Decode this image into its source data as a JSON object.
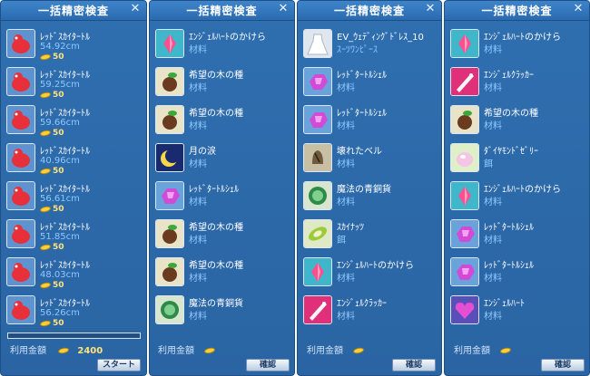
{
  "panels": [
    {
      "title": "一括精密検査",
      "items": [
        {
          "name": "ﾚｯﾄﾞｽｶｲﾀｰﾄﾙ",
          "sub": "54.92cm",
          "cost": "50",
          "icon": "red-sky-turtle-icon"
        },
        {
          "name": "ﾚｯﾄﾞｽｶｲﾀｰﾄﾙ",
          "sub": "59.25cm",
          "cost": "50",
          "icon": "red-sky-turtle-icon"
        },
        {
          "name": "ﾚｯﾄﾞｽｶｲﾀｰﾄﾙ",
          "sub": "59.66cm",
          "cost": "50",
          "icon": "red-sky-turtle-icon"
        },
        {
          "name": "ﾚｯﾄﾞｽｶｲﾀｰﾄﾙ",
          "sub": "40.96cm",
          "cost": "50",
          "icon": "red-sky-turtle-icon"
        },
        {
          "name": "ﾚｯﾄﾞｽｶｲﾀｰﾄﾙ",
          "sub": "56.61cm",
          "cost": "50",
          "icon": "red-sky-turtle-icon"
        },
        {
          "name": "ﾚｯﾄﾞｽｶｲﾀｰﾄﾙ",
          "sub": "51.85cm",
          "cost": "50",
          "icon": "red-sky-turtle-icon"
        },
        {
          "name": "ﾚｯﾄﾞｽｶｲﾀｰﾄﾙ",
          "sub": "48.03cm",
          "cost": "50",
          "icon": "red-sky-turtle-icon"
        },
        {
          "name": "ﾚｯﾄﾞｽｶｲﾀｰﾄﾙ",
          "sub": "56.26cm",
          "cost": "50",
          "icon": "red-sky-turtle-icon"
        }
      ],
      "progress": 0,
      "usage_label": "利用金額",
      "total": "2400",
      "button": "スタート"
    },
    {
      "title": "一括精密検査",
      "items": [
        {
          "name": "ｴﾝｼﾞｪﾙﾊｰﾄのかけら",
          "sub": "材料",
          "icon": "angel-heart-fragment-icon"
        },
        {
          "name": "希望の木の種",
          "sub": "材料",
          "icon": "hope-tree-seed-icon"
        },
        {
          "name": "希望の木の種",
          "sub": "材料",
          "icon": "hope-tree-seed-icon"
        },
        {
          "name": "月の涙",
          "sub": "材料",
          "icon": "moon-tear-icon"
        },
        {
          "name": "ﾚｯﾄﾞﾀｰﾄﾙｼｪﾙ",
          "sub": "材料",
          "icon": "red-turtle-shell-icon"
        },
        {
          "name": "希望の木の種",
          "sub": "材料",
          "icon": "hope-tree-seed-icon"
        },
        {
          "name": "希望の木の種",
          "sub": "材料",
          "icon": "hope-tree-seed-icon"
        },
        {
          "name": "魔法の青銅貨",
          "sub": "材料",
          "icon": "magic-bronze-coin-icon"
        }
      ],
      "usage_label": "利用金額",
      "button": "確認"
    },
    {
      "title": "一括精密検査",
      "items": [
        {
          "name": "EV_ｳｪﾃﾞｨﾝｸﾞﾄﾞﾚｽ_10",
          "sub": "ｽｰﾂﾜﾝﾋﾟｰｽ",
          "icon": "wedding-dress-icon"
        },
        {
          "name": "ﾚｯﾄﾞﾀｰﾄﾙｼｪﾙ",
          "sub": "材料",
          "icon": "red-turtle-shell-icon"
        },
        {
          "name": "ﾚｯﾄﾞﾀｰﾄﾙｼｪﾙ",
          "sub": "材料",
          "icon": "red-turtle-shell-icon"
        },
        {
          "name": "壊れたベル",
          "sub": "材料",
          "icon": "broken-bell-icon"
        },
        {
          "name": "魔法の青銅貨",
          "sub": "材料",
          "icon": "magic-bronze-coin-icon"
        },
        {
          "name": "ｽｶｲﾅｯﾂ",
          "sub": "餌",
          "icon": "sky-nuts-icon"
        },
        {
          "name": "ｴﾝｼﾞｪﾙﾊｰﾄのかけら",
          "sub": "材料",
          "icon": "angel-heart-fragment-icon"
        },
        {
          "name": "ｴﾝｼﾞｪﾙｸﾗｯｶｰ",
          "sub": "材料",
          "icon": "angel-cracker-icon"
        }
      ],
      "usage_label": "利用金額",
      "button": "確認"
    },
    {
      "title": "一括精密検査",
      "items": [
        {
          "name": "ｴﾝｼﾞｪﾙﾊｰﾄのかけら",
          "sub": "材料",
          "icon": "angel-heart-fragment-icon"
        },
        {
          "name": "ｴﾝｼﾞｪﾙｸﾗｯｶｰ",
          "sub": "材料",
          "icon": "angel-cracker-icon"
        },
        {
          "name": "希望の木の種",
          "sub": "材料",
          "icon": "hope-tree-seed-icon"
        },
        {
          "name": "ﾀﾞｲﾔﾓﾝﾄﾞｾﾞﾘｰ",
          "sub": "餌",
          "icon": "diamond-jelly-icon"
        },
        {
          "name": "ｴﾝｼﾞｪﾙﾊｰﾄのかけら",
          "sub": "材料",
          "icon": "angel-heart-fragment-icon"
        },
        {
          "name": "ﾚｯﾄﾞﾀｰﾄﾙｼｪﾙ",
          "sub": "材料",
          "icon": "red-turtle-shell-icon"
        },
        {
          "name": "ﾚｯﾄﾞﾀｰﾄﾙｼｪﾙ",
          "sub": "材料",
          "icon": "red-turtle-shell-icon"
        },
        {
          "name": "ｴﾝｼﾞｪﾙﾊｰﾄ",
          "sub": "材料",
          "icon": "angel-heart-icon"
        }
      ],
      "usage_label": "利用金額",
      "button": "確認"
    }
  ],
  "colors": {
    "panel_bg": "#2f6fb0",
    "sub_text": "#8ec8ff",
    "gold_text": "#ffe27a"
  }
}
